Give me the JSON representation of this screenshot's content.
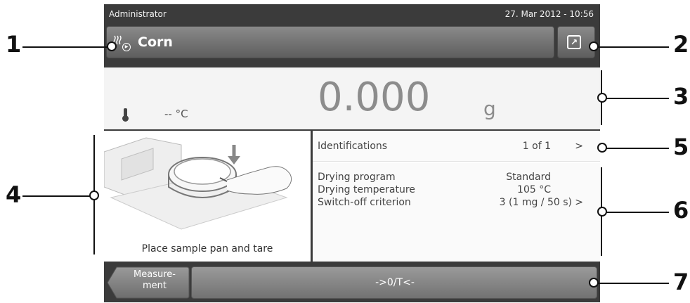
{
  "status_bar": {
    "user": "Administrator",
    "datetime": "27. Mar 2012 - 10:56"
  },
  "title_bar": {
    "method_icon": "drying-method-icon",
    "title": "Corn",
    "shortcut_icon": "shortcut-arrow-icon"
  },
  "weight": {
    "temperature": "-- °C",
    "value": "0.000",
    "unit": "g",
    "thermometer_icon": "thermometer-icon"
  },
  "illustration": {
    "caption": "Place sample pan and tare"
  },
  "identifications": {
    "label": "Identifications",
    "value": "1 of 1",
    "chevron": ">"
  },
  "drying": {
    "program_label": "Drying program",
    "program_value": "Standard",
    "temperature_label": "Drying temperature",
    "temperature_value": "105 °C",
    "switchoff_label": "Switch-off criterion",
    "switchoff_value": "3  (1 mg / 50 s)",
    "chevron": ">"
  },
  "bottom_bar": {
    "back_label_line1": "Measure-",
    "back_label_line2": "ment",
    "action_label": "->0/T<-"
  },
  "callouts": [
    "1",
    "2",
    "3",
    "4",
    "5",
    "6",
    "7"
  ]
}
